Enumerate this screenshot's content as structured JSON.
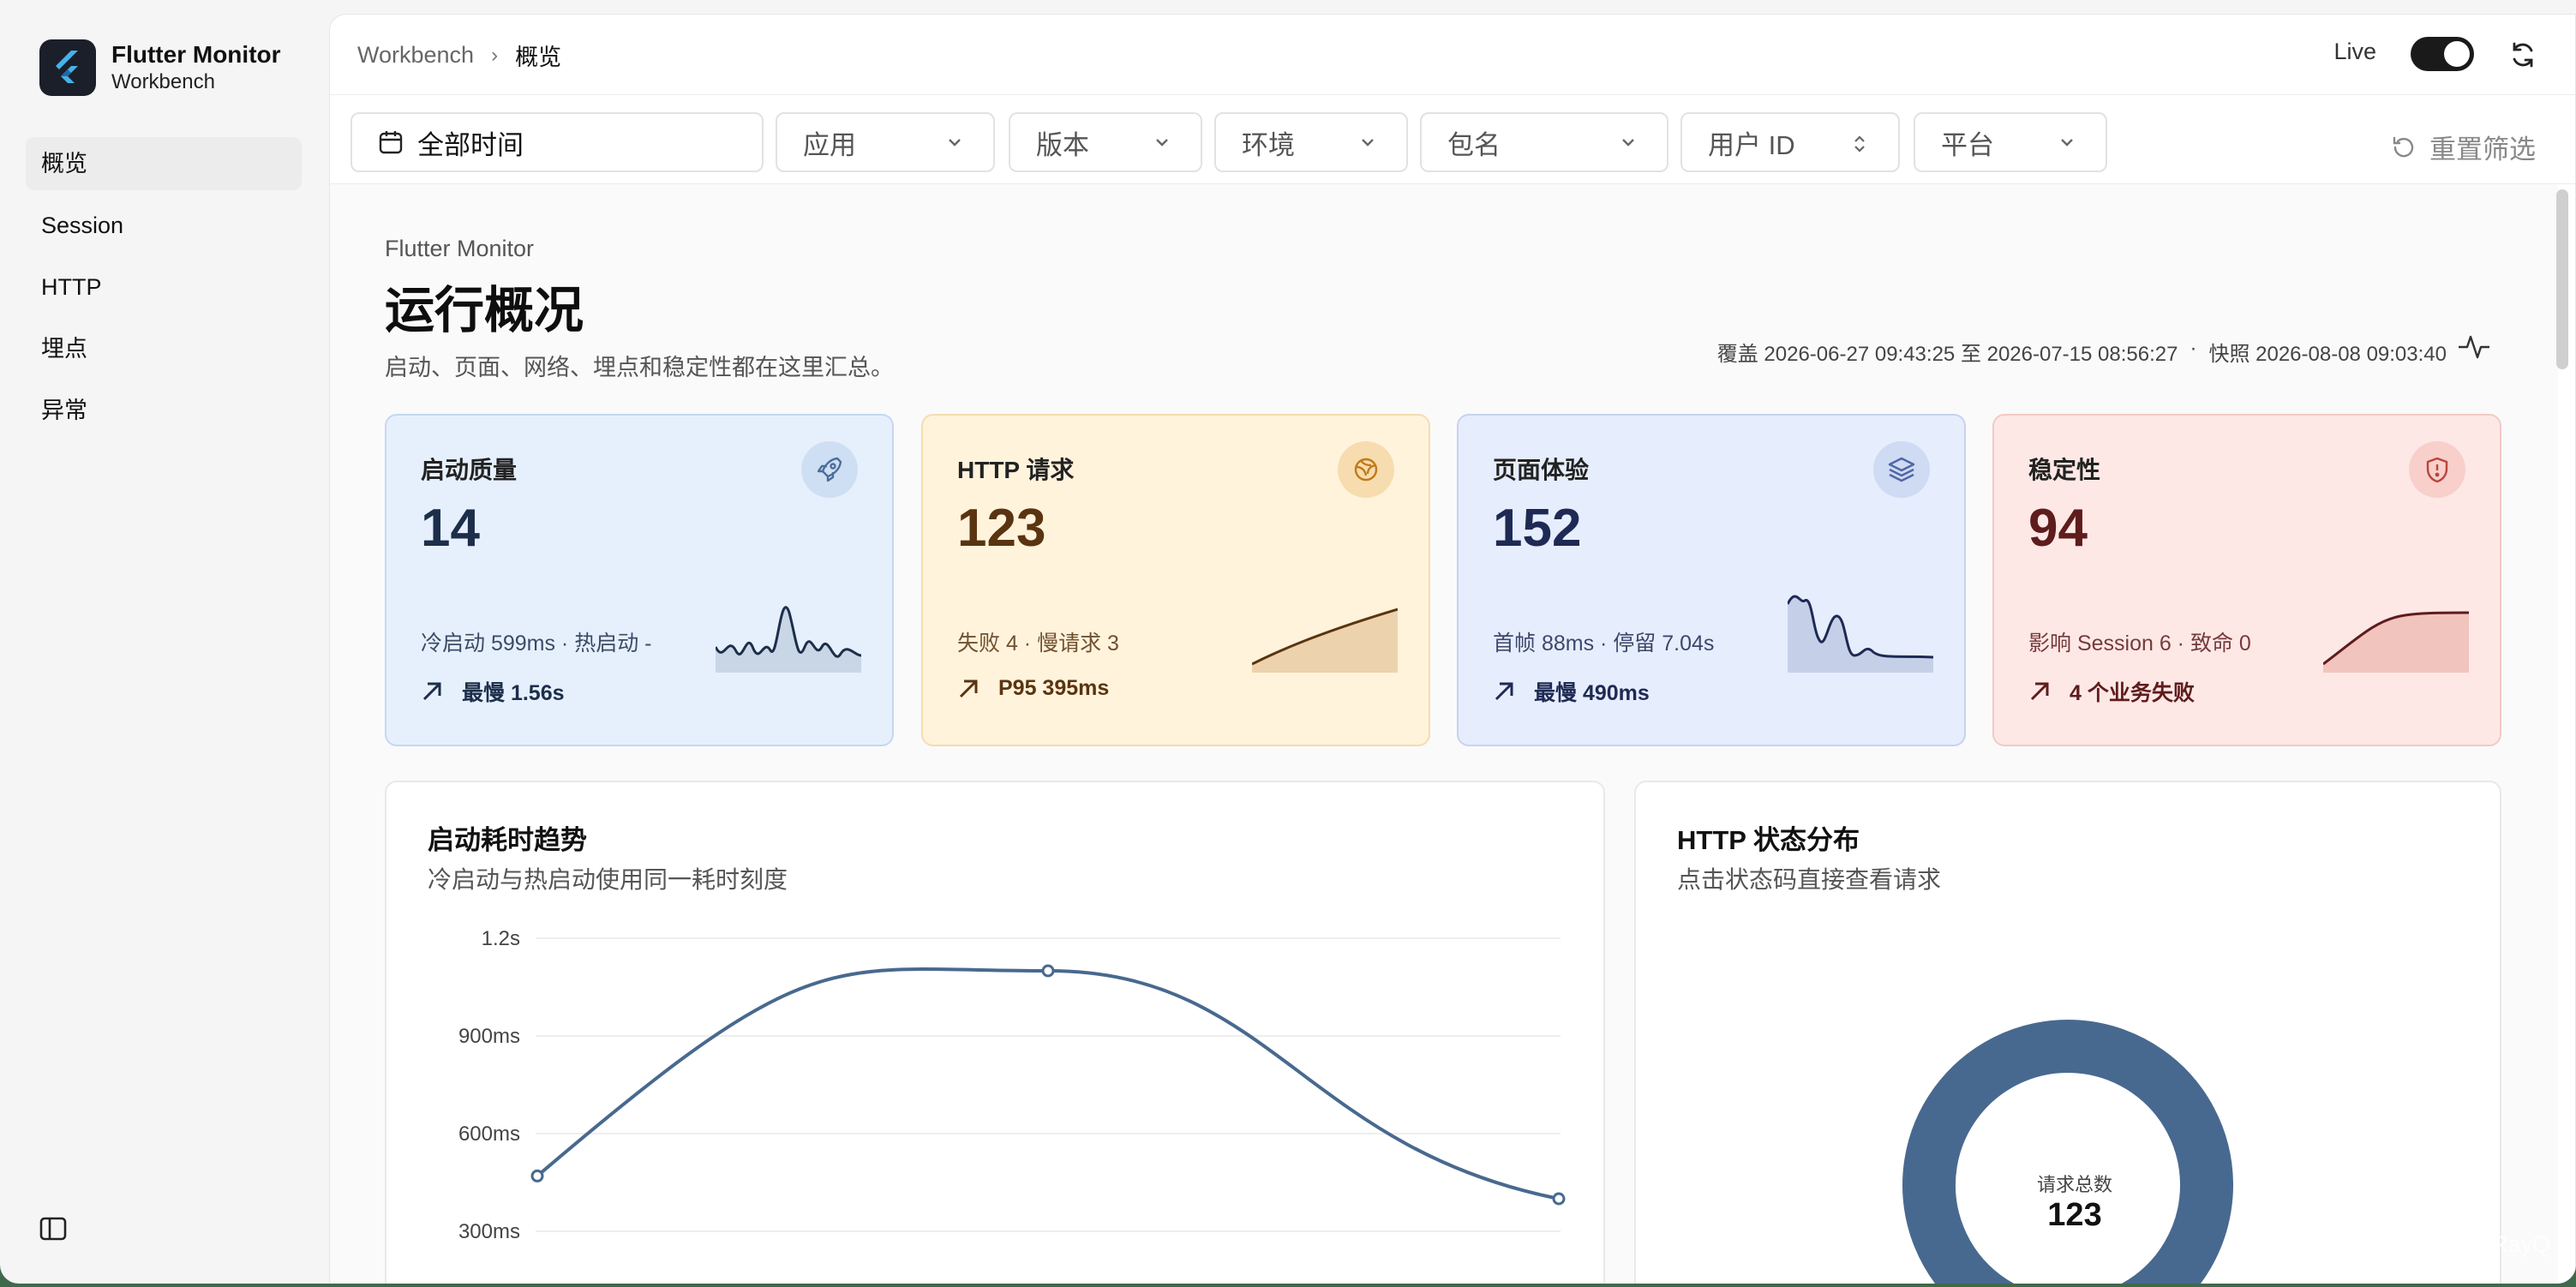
{
  "brand": {
    "title": "Flutter Monitor",
    "subtitle": "Workbench"
  },
  "nav": [
    {
      "label": "概览",
      "active": true
    },
    {
      "label": "Session",
      "active": false
    },
    {
      "label": "HTTP",
      "active": false
    },
    {
      "label": "埋点",
      "active": false
    },
    {
      "label": "异常",
      "active": false
    }
  ],
  "breadcrumb": {
    "root": "Workbench",
    "current": "概览"
  },
  "topbar": {
    "live_label": "Live",
    "live_on": true
  },
  "filters": {
    "time": "全部时间",
    "app": "应用",
    "version": "版本",
    "env": "环境",
    "package": "包名",
    "user_id": "用户 ID",
    "platform": "平台",
    "reset": "重置筛选"
  },
  "header": {
    "eyebrow": "Flutter Monitor",
    "title": "运行概况",
    "desc": "启动、页面、网络、埋点和稳定性都在这里汇总。",
    "coverage": "覆盖 2026-06-27 09:43:25 至 2026-07-15 08:56:27",
    "dot": "·",
    "snapshot": "快照 2026-08-08 09:03:40"
  },
  "cards": [
    {
      "title": "启动质量",
      "value": "14",
      "sub": "冷启动 599ms · 热启动 -",
      "foot": "最慢 1.56s",
      "icon": "rocket-icon",
      "bg": "#e6f0fc",
      "border": "#c4d8f0",
      "color": "#1c2e4a"
    },
    {
      "title": "HTTP 请求",
      "value": "123",
      "sub": "失败 4 · 慢请求 3",
      "foot": "P95 395ms",
      "icon": "network-icon",
      "bg": "#fff3dc",
      "border": "#f3ddb0",
      "color": "#5a3410"
    },
    {
      "title": "页面体验",
      "value": "152",
      "sub": "首帧 88ms · 停留 7.04s",
      "foot": "最慢 490ms",
      "icon": "layers-icon",
      "bg": "#e6edfc",
      "border": "#c6d3f0",
      "color": "#1e2a54"
    },
    {
      "title": "稳定性",
      "value": "94",
      "sub": "影响 Session 6 · 致命 0",
      "foot": "4 个业务失败",
      "icon": "shield-alert-icon",
      "bg": "#fde8e6",
      "border": "#f4c9c4",
      "color": "#5e1c1c"
    }
  ],
  "startup_panel": {
    "title": "启动耗时趋势",
    "subtitle": "冷启动与热启动使用同一耗时刻度"
  },
  "http_panel": {
    "title": "HTTP 状态分布",
    "subtitle": "点击状态码直接查看请求",
    "center_label": "请求总数",
    "center_value": "123"
  },
  "chart_data": [
    {
      "type": "line",
      "title": "启动耗时趋势",
      "yticks": [
        "1.2s",
        "900ms",
        "600ms",
        "300ms"
      ],
      "ylim": [
        300,
        1200
      ],
      "series": [
        {
          "values": [
            470,
            1100,
            400
          ]
        }
      ],
      "colors": {
        "line": "#48698f"
      }
    },
    {
      "type": "pie",
      "title": "HTTP 状态分布",
      "total": 123,
      "slices": [
        {
          "value": 119,
          "color": "#48698f"
        },
        {
          "value": 1,
          "color": "#d98f86"
        },
        {
          "value": 1,
          "color": "#c9564d"
        },
        {
          "value": 2,
          "color": "#e0181b"
        }
      ]
    }
  ],
  "watermark": "掘金技术社区 @ LINRayQ"
}
